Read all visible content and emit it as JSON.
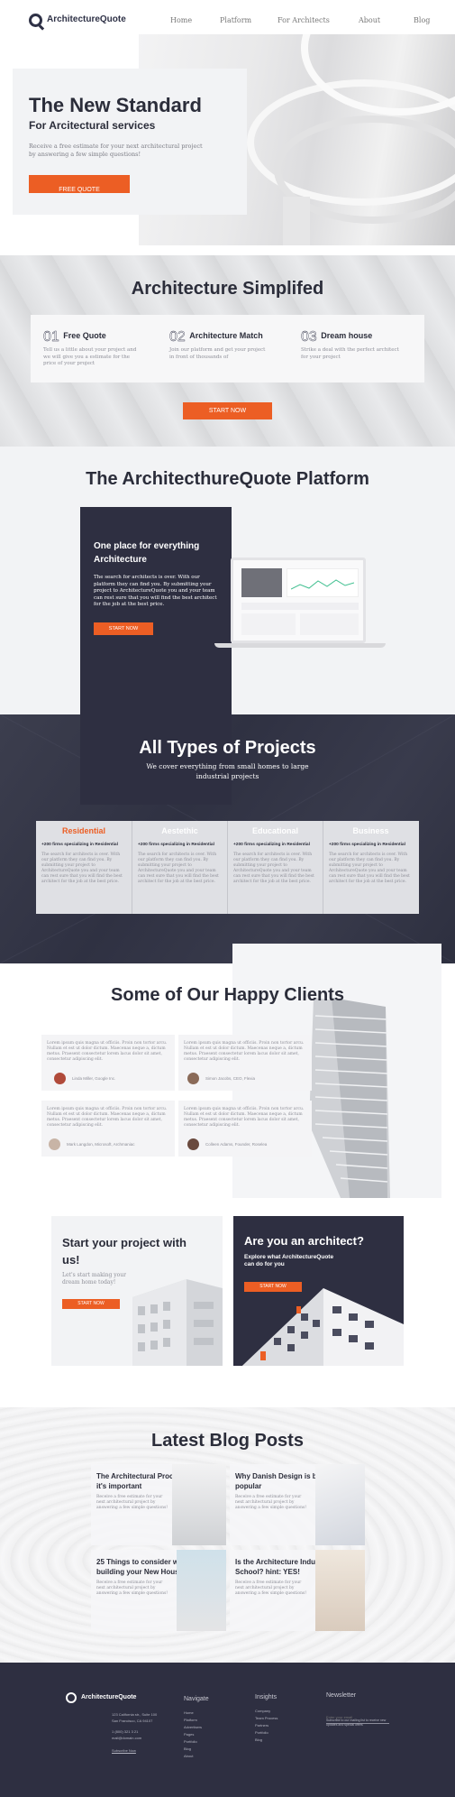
{
  "header": {
    "logo": "ArchitectureQuote",
    "nav": [
      "Home",
      "Platform",
      "For Architects",
      "About",
      "Blog"
    ]
  },
  "hero": {
    "title": "The New Standard",
    "subtitle": "For Arcitectural services",
    "description": "Receive a free estimate for your next architectural project by answering a few simple questions!",
    "button": "FREE QUOTE"
  },
  "simplified": {
    "title": "Architecture Simplifed",
    "steps": [
      {
        "num": "01",
        "title": "Free Quote",
        "text": "Tell us a little about your project and we will give you a estimate for the price of your project"
      },
      {
        "num": "02",
        "title": "Architecture Match",
        "text": "Join our platform and get your project in front of thousands of"
      },
      {
        "num": "03",
        "title": "Dream house",
        "text": "Strike a deal with the perfect architect for your project"
      }
    ],
    "button": "START NOW"
  },
  "platform": {
    "title": "The ArchitecthureQuote Platform",
    "card_title": "One place for everything Architecture",
    "card_text": "The search for architects is over. With our platform they can find you. By submitting your project to ArchitectureQuote you and your team can rest sure that you will find the best architect for the job at the best price.",
    "button": "START NOW"
  },
  "projects": {
    "title": "All Types of Projects",
    "subtitle": "We cover everything from small homes to large industrial projects",
    "columns": [
      {
        "name": "Residential",
        "stat": "+200 firms specializing in Residential",
        "text": "The search for architects is over. With our platform they can find you. By submitting your project to ArchitectureQuote you and your team can rest sure that you will find the best architect for the job at the best price."
      },
      {
        "name": "Aestethic",
        "stat": "+200 firms specializing in Residential",
        "text": "The search for architects is over. With our platform they can find you. By submitting your project to ArchitectureQuote you and your team can rest sure that you will find the best architect for the job at the best price."
      },
      {
        "name": "Educational",
        "stat": "+200 firms specializing in Residential",
        "text": "The search for architects is over. With our platform they can find you. By submitting your project to ArchitectureQuote you and your team can rest sure that you will find the best architect for the job at the best price."
      },
      {
        "name": "Business",
        "stat": "+200 firms specializing in Residential",
        "text": "The search for architects is over. With our platform they can find you. By submitting your project to ArchitectureQuote you and your team can rest sure that you will find the best architect for the job at the best price."
      }
    ]
  },
  "clients": {
    "title": "Some of Our Happy Clients",
    "testimonials": [
      {
        "text": "Lorem ipsum quis magna ut officiis. Proin non tortor arcu. Nullam et est ut dolor dictum. Maecenas neque a, dictum metus. Praesent consectetur lorem lacus dolor sit amet, consectetur adipiscing elit.",
        "name": "Linda Miller, Google Inc."
      },
      {
        "text": "Lorem ipsum quis magna ut officiis. Proin non tortor arcu. Nullam et est ut dolor dictum. Maecenas neque a, dictum metus. Praesent consectetur lorem lacus dolor sit amet, consectetur adipiscing elit.",
        "name": "Simon Jacobs, CEO, Flexia"
      },
      {
        "text": "Lorem ipsum quis magna ut officiis. Proin non tortor arcu. Nullam et est ut dolor dictum. Maecenas neque a, dictum metus. Praesent consectetur lorem lacus dolor sit amet, consectetur adipiscing elit.",
        "name": "Mark Langdon, Microsoft, Archmaniac"
      },
      {
        "text": "Lorem ipsum quis magna ut officiis. Proin non tortor arcu. Nullam et est ut dolor dictum. Maecenas neque a, dictum metus. Praesent consectetur lorem lacus dolor sit amet, consectetur adipiscing elit.",
        "name": "Colleen Adams, Founder, Roselea"
      }
    ]
  },
  "cta": {
    "left_title": "Start your project with us!",
    "left_text": "Let's start making your dream home today!",
    "left_button": "START NOW",
    "right_title": "Are you an architect?",
    "right_text": "Explore what ArchitectureQuote can do for you",
    "right_button": "START NOW"
  },
  "blog": {
    "title": "Latest Blog Posts",
    "posts": [
      {
        "title": "The Architectural Process & Why it's important",
        "text": "Receive a free estimate for your next architectural project by answering a few simple questions!"
      },
      {
        "title": "Why Danish Design is becoming popular",
        "text": "Receive a free estimate for your next architectural project by answering a few simple questions!"
      },
      {
        "title": "25 Things to consider when building your New House",
        "text": "Receive a free estimate for your next architectural project by answering a few simple questions!"
      },
      {
        "title": "Is the Architecture Industry Old School? hint: YES!",
        "text": "Receive a free estimate for your next architectural project by answering a few simple questions!"
      }
    ]
  },
  "footer": {
    "logo": "ArchitectureQuote",
    "address": [
      "123 California str., Suite 100",
      "San Francisco, CA 94107"
    ],
    "phone": "1 (800) 321 3 21",
    "email": "mail@domain.com",
    "subscribe": "Subscribe Now",
    "navigate_title": "Navigate",
    "navigate": [
      "Home",
      "Platform",
      "Advertisers",
      "Pages",
      "Portfolio",
      "Blog",
      "About"
    ],
    "insights_title": "Insights",
    "insights": [
      "Company",
      "Team Process",
      "Partners",
      "Portfolio",
      "Blog"
    ],
    "newsletter_title": "Newsletter",
    "newsletter_placeholder": "Enter your email",
    "newsletter_note": "Subscribe to our mailing list to receive new updates and special offers"
  }
}
